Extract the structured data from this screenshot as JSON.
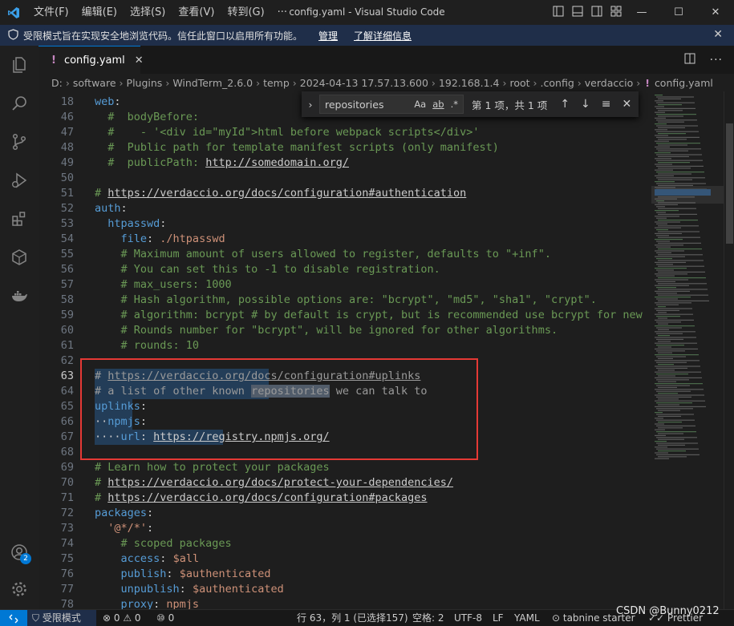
{
  "window": {
    "title": "config.yaml - Visual Studio Code",
    "menu": [
      "文件(F)",
      "编辑(E)",
      "选择(S)",
      "查看(V)",
      "转到(G)",
      "···"
    ],
    "controls": [
      "—",
      "☐",
      "✕"
    ]
  },
  "banner": {
    "message": "受限模式旨在实现安全地浏览代码。信任此窗口以启用所有功能。",
    "manage_link": "管理",
    "details_link": "了解详细信息"
  },
  "activity": {
    "items": [
      "explorer-icon",
      "search-icon",
      "source-control-icon",
      "run-debug-icon",
      "extensions-icon",
      "remote-icon",
      "docker-icon"
    ],
    "accounts_badge": "2"
  },
  "tab": {
    "name": "config.yaml",
    "modified_mark": "!"
  },
  "breadcrumb": [
    "D:",
    "software",
    "Plugins",
    "WindTerm_2.6.0",
    "temp",
    "2024-04-13 17.57.13.600",
    "192.168.1.4",
    "root",
    ".config",
    "verdaccio",
    "config.yaml"
  ],
  "find": {
    "query": "repositories",
    "opt_case": "Aa",
    "opt_word": "ab",
    "opt_regex": ".*",
    "result": "第 1 项，共 1 项"
  },
  "editor": {
    "active_line": "63",
    "lines": [
      {
        "n": "18",
        "parts": [
          [
            "key",
            "web"
          ],
          [
            "val",
            ":"
          ]
        ]
      },
      {
        "n": "46",
        "parts": [
          [
            "val",
            "  "
          ],
          [
            "comment",
            "#  bodyBefore:"
          ]
        ]
      },
      {
        "n": "47",
        "parts": [
          [
            "val",
            "  "
          ],
          [
            "comment",
            "#    - '<div id=\"myId\">html before webpack scripts</div>'"
          ]
        ]
      },
      {
        "n": "48",
        "parts": [
          [
            "val",
            "  "
          ],
          [
            "comment",
            "#  Public path for template manifest scripts (only manifest)"
          ]
        ]
      },
      {
        "n": "49",
        "parts": [
          [
            "val",
            "  "
          ],
          [
            "comment",
            "#  publicPath: "
          ],
          [
            "clink",
            "http://somedomain.org/"
          ]
        ]
      },
      {
        "n": "50",
        "parts": []
      },
      {
        "n": "51",
        "parts": [
          [
            "comment",
            "# "
          ],
          [
            "clink",
            "https://verdaccio.org/docs/configuration#authentication"
          ]
        ]
      },
      {
        "n": "52",
        "parts": [
          [
            "key",
            "auth"
          ],
          [
            "val",
            ":"
          ]
        ]
      },
      {
        "n": "53",
        "parts": [
          [
            "val",
            "  "
          ],
          [
            "key",
            "htpasswd"
          ],
          [
            "val",
            ":"
          ]
        ]
      },
      {
        "n": "54",
        "parts": [
          [
            "val",
            "    "
          ],
          [
            "key",
            "file"
          ],
          [
            "val",
            ": "
          ],
          [
            "str",
            "./htpasswd"
          ]
        ]
      },
      {
        "n": "55",
        "parts": [
          [
            "val",
            "    "
          ],
          [
            "comment",
            "# Maximum amount of users allowed to register, defaults to \"+inf\"."
          ]
        ]
      },
      {
        "n": "56",
        "parts": [
          [
            "val",
            "    "
          ],
          [
            "comment",
            "# You can set this to -1 to disable registration."
          ]
        ]
      },
      {
        "n": "57",
        "parts": [
          [
            "val",
            "    "
          ],
          [
            "comment",
            "# max_users: 1000"
          ]
        ]
      },
      {
        "n": "58",
        "parts": [
          [
            "val",
            "    "
          ],
          [
            "comment",
            "# Hash algorithm, possible options are: \"bcrypt\", \"md5\", \"sha1\", \"crypt\"."
          ]
        ]
      },
      {
        "n": "59",
        "parts": [
          [
            "val",
            "    "
          ],
          [
            "comment",
            "# algorithm: bcrypt # by default is crypt, but is recommended use bcrypt for new"
          ]
        ]
      },
      {
        "n": "60",
        "parts": [
          [
            "val",
            "    "
          ],
          [
            "comment",
            "# Rounds number for \"bcrypt\", will be ignored for other algorithms."
          ]
        ]
      },
      {
        "n": "61",
        "parts": [
          [
            "val",
            "    "
          ],
          [
            "comment",
            "# rounds: 10"
          ]
        ]
      },
      {
        "n": "62",
        "parts": []
      },
      {
        "n": "63",
        "sel": 25,
        "parts": [
          [
            "cm",
            "# "
          ],
          [
            "cmlink",
            "https://verdaccio.org/docs/configuration#uplinks"
          ]
        ]
      },
      {
        "n": "64",
        "sel": 25,
        "parts": [
          [
            "cm",
            "# a list of other known "
          ],
          [
            "rep",
            "repositories"
          ],
          [
            "cm",
            " we can talk to"
          ]
        ]
      },
      {
        "n": "65",
        "sel": 4,
        "parts": [
          [
            "key",
            "uplinks"
          ],
          [
            "val",
            ":"
          ]
        ]
      },
      {
        "n": "66",
        "sel": 4,
        "parts": [
          [
            "val",
            "··"
          ],
          [
            "key",
            "npmjs"
          ],
          [
            "val",
            ":"
          ]
        ]
      },
      {
        "n": "67",
        "sel": 18,
        "parts": [
          [
            "val",
            "····"
          ],
          [
            "key",
            "url"
          ],
          [
            "val",
            ": "
          ],
          [
            "strlink",
            "https://registry.npmjs.org/"
          ]
        ]
      },
      {
        "n": "68",
        "parts": []
      },
      {
        "n": "69",
        "parts": [
          [
            "comment",
            "# Learn how to protect your packages"
          ]
        ]
      },
      {
        "n": "70",
        "parts": [
          [
            "comment",
            "# "
          ],
          [
            "clink",
            "https://verdaccio.org/docs/protect-your-dependencies/"
          ]
        ]
      },
      {
        "n": "71",
        "parts": [
          [
            "comment",
            "# "
          ],
          [
            "clink",
            "https://verdaccio.org/docs/configuration#packages"
          ]
        ]
      },
      {
        "n": "72",
        "parts": [
          [
            "key",
            "packages"
          ],
          [
            "val",
            ":"
          ]
        ]
      },
      {
        "n": "73",
        "parts": [
          [
            "val",
            "  "
          ],
          [
            "str",
            "'@*/*'"
          ],
          [
            "val",
            ":"
          ]
        ]
      },
      {
        "n": "74",
        "parts": [
          [
            "val",
            "    "
          ],
          [
            "comment",
            "# scoped packages"
          ]
        ]
      },
      {
        "n": "75",
        "parts": [
          [
            "val",
            "    "
          ],
          [
            "key",
            "access"
          ],
          [
            "val",
            ": "
          ],
          [
            "str",
            "$all"
          ]
        ]
      },
      {
        "n": "76",
        "parts": [
          [
            "val",
            "    "
          ],
          [
            "key",
            "publish"
          ],
          [
            "val",
            ": "
          ],
          [
            "str",
            "$authenticated"
          ]
        ]
      },
      {
        "n": "77",
        "parts": [
          [
            "val",
            "    "
          ],
          [
            "key",
            "unpublish"
          ],
          [
            "val",
            ": "
          ],
          [
            "str",
            "$authenticated"
          ]
        ]
      },
      {
        "n": "78",
        "parts": [
          [
            "val",
            "    "
          ],
          [
            "key",
            "proxy"
          ],
          [
            "val",
            ": "
          ],
          [
            "str",
            "npmjs"
          ]
        ]
      }
    ]
  },
  "status": {
    "restricted": "受限模式",
    "problems": "⊗ 0 ⚠ 0",
    "ports": "⑩ 0",
    "cursor": "行 63，列 1 (已选择157)",
    "indent": "空格: 2",
    "encoding": "UTF-8",
    "eol": "LF",
    "language": "YAML",
    "tabnine": "⊙ tabnine starter",
    "prettier": "✓✓ Prettier",
    "watermark": "CSDN @Bunny0212"
  },
  "colors": {
    "accent": "#0078d4",
    "annotation": "#e53935"
  }
}
